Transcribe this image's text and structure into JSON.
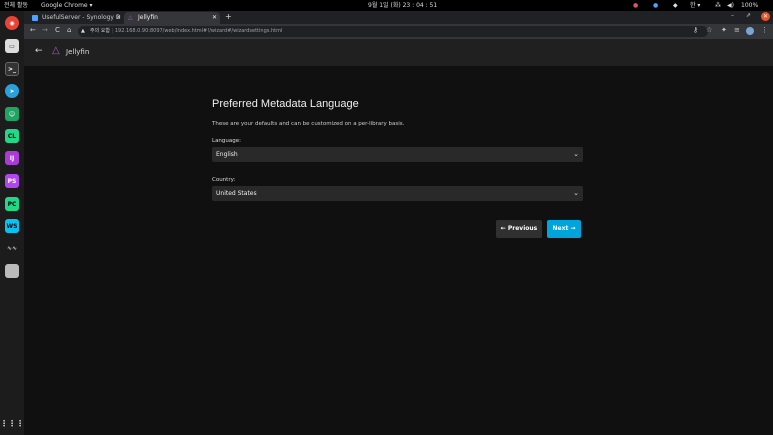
{
  "system": {
    "activities": "전체 활동",
    "app_menu": "Google Chrome ▾",
    "clock": "9월 1일 (화) 23 : 04 : 51",
    "lang": "한 ▾",
    "battery": "100%"
  },
  "browser": {
    "tabs": [
      {
        "label": "UsefulServer - Synology D"
      },
      {
        "label": "Jellyfin"
      }
    ],
    "security_label": "주의 요함",
    "url": "192.168.0.90:8097/web/index.html#!/wizard#/wizardsettings.html"
  },
  "app": {
    "name": "Jellyfin"
  },
  "wizard": {
    "title": "Preferred Metadata Language",
    "description": "These are your defaults and can be customized on a per-library basis.",
    "language_label": "Language:",
    "language_value": "English",
    "country_label": "Country:",
    "country_value": "United States",
    "previous_label": "← Previous",
    "next_label": "Next →"
  },
  "colors": {
    "accent": "#00a4dc",
    "background": "#101010",
    "header": "#202020",
    "input": "#292929"
  }
}
